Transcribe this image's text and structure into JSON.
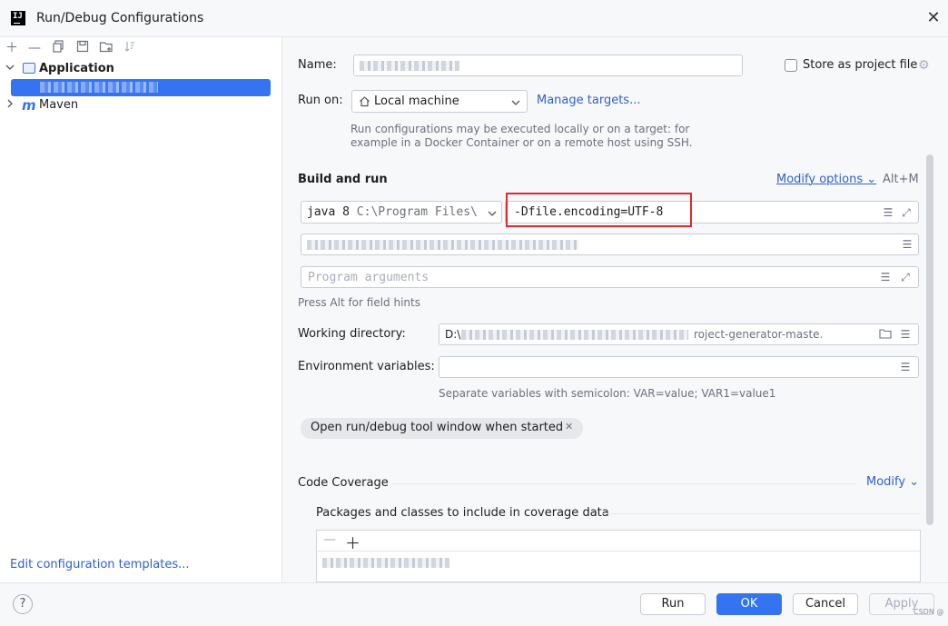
{
  "window": {
    "title": "Run/Debug Configurations",
    "logo_text": "IJ"
  },
  "left": {
    "tree": {
      "application": "Application",
      "maven": "Maven",
      "maven_mark": "m"
    },
    "edit_templates_link": "Edit configuration templates..."
  },
  "form": {
    "name_label": "Name:",
    "store_label": "Store as project file",
    "run_on_label": "Run on:",
    "run_on_value": "Local machine",
    "manage_targets": "Manage targets...",
    "run_on_hint_1": "Run configurations may be executed locally or on a target: for",
    "run_on_hint_2": "example in a Docker Container or on a remote host using SSH.",
    "build_and_run": "Build and run",
    "modify_options": "Modify options",
    "modify_shortcut": "Alt+M",
    "jdk_name": "java 8",
    "jdk_path": "C:\\Program Files\\",
    "vm_options_value": "-Dfile.encoding=UTF-8",
    "program_args_placeholder": "Program arguments",
    "field_hints": "Press Alt for field hints",
    "working_dir_label": "Working directory:",
    "working_dir_value_start": "D:\\",
    "working_dir_value_end": "roject-generator-maste.",
    "env_label": "Environment variables:",
    "env_hint": "Separate variables with semicolon: VAR=value; VAR1=value1",
    "open_tool_window_chip": "Open run/debug tool window when started",
    "code_coverage": "Code Coverage",
    "modify": "Modify",
    "packages_label": "Packages and classes to include in coverage data"
  },
  "buttons": {
    "help": "?",
    "run": "Run",
    "ok": "OK",
    "cancel": "Cancel",
    "apply": "Apply"
  },
  "watermark": "CSDN @",
  "colors": {
    "accent": "#3574f0",
    "link": "#2f5fd0",
    "highlight_box": "#e0282e"
  }
}
